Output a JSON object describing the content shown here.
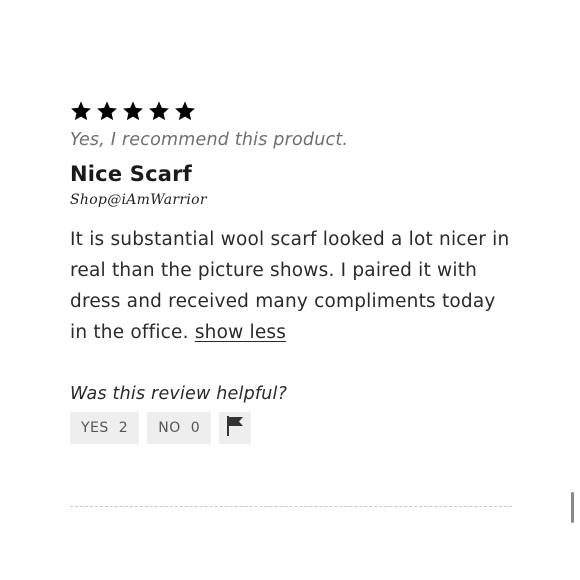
{
  "review": {
    "rating": 5,
    "rating_max": 5,
    "recommend_text": "Yes, I recommend this product.",
    "title": "Nice Scarf",
    "author": "Shop@iAmWarrior",
    "body": "It is substantial wool scarf looked a lot nicer in real than the picture shows. I paired it with dress and received many compliments today in the office.",
    "show_less_label": "show less"
  },
  "helpful": {
    "question": "Was this review helpful?",
    "yes_label": "YES",
    "yes_count": "2",
    "no_label": "NO",
    "no_count": "0",
    "report_icon": "flag-icon"
  },
  "colors": {
    "star": "#000000",
    "button_bg": "#eeeeee",
    "muted_text": "#6f6f6f"
  }
}
